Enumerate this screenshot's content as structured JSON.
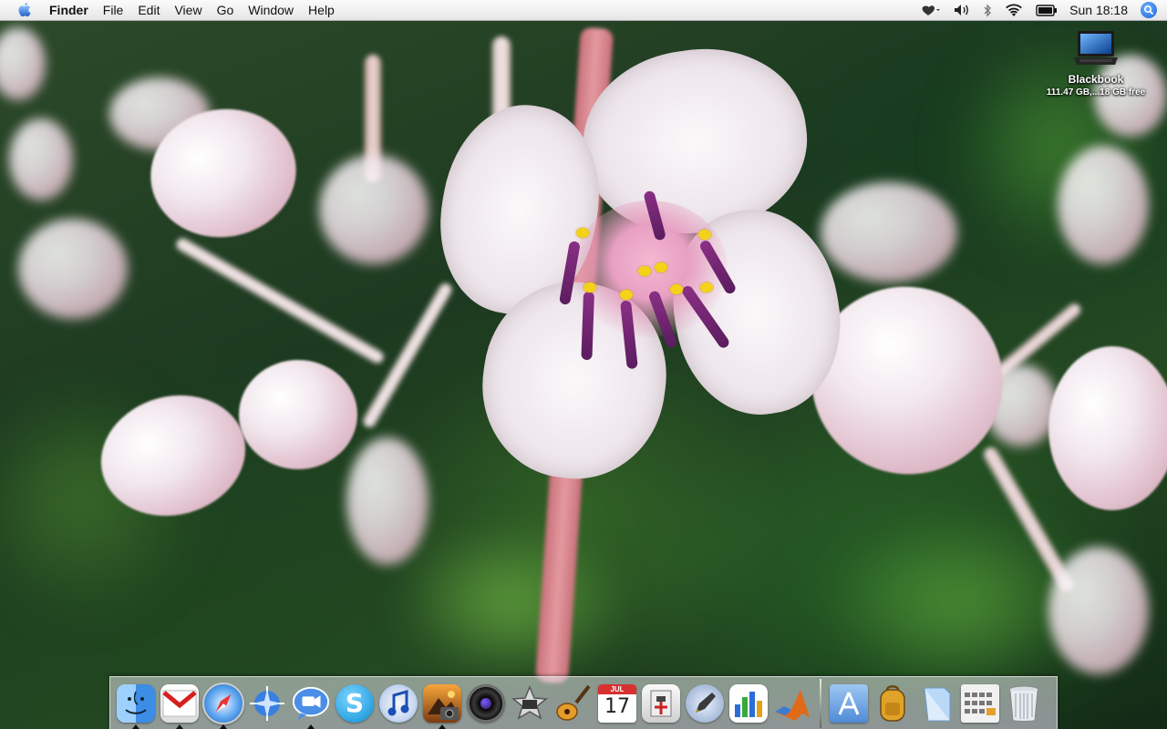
{
  "menubar": {
    "app_name": "Finder",
    "menus": [
      "File",
      "Edit",
      "View",
      "Go",
      "Window",
      "Help"
    ],
    "clock": "Sun 18:18"
  },
  "desktop": {
    "disk_name": "Blackbook",
    "disk_info": "111.47 GB,...18 GB free"
  },
  "dock": {
    "apps": [
      {
        "name": "Finder",
        "icon": "finder-icon",
        "running": true
      },
      {
        "name": "Mail",
        "icon": "mail-icon",
        "running": true
      },
      {
        "name": "Safari",
        "icon": "safari-icon",
        "running": true
      },
      {
        "name": "Globe",
        "icon": "globe-icon",
        "running": false
      },
      {
        "name": "iChat",
        "icon": "ichat-icon",
        "running": true
      },
      {
        "name": "Skype",
        "icon": "skype-icon",
        "running": false
      },
      {
        "name": "iTunes",
        "icon": "itunes-icon",
        "running": false
      },
      {
        "name": "iPhoto",
        "icon": "iphoto-icon",
        "running": true
      },
      {
        "name": "Aperture",
        "icon": "aperture-icon",
        "running": false
      },
      {
        "name": "iMovie",
        "icon": "imovie-icon",
        "running": false
      },
      {
        "name": "GarageBand",
        "icon": "garageband-icon",
        "running": false
      },
      {
        "name": "iCal",
        "icon": "ical-icon",
        "running": false
      },
      {
        "name": "Utility",
        "icon": "utility-icon",
        "running": false
      },
      {
        "name": "Script Editor",
        "icon": "pen-icon",
        "running": false
      },
      {
        "name": "Charts",
        "icon": "charts-icon",
        "running": false
      },
      {
        "name": "MATLAB",
        "icon": "matlab-icon",
        "running": false
      }
    ],
    "calendar_day": "17",
    "calendar_month": "JUL",
    "folders": [
      {
        "name": "Applications",
        "icon": "applications-folder-icon"
      },
      {
        "name": "Backpack",
        "icon": "backpack-icon"
      },
      {
        "name": "Documents",
        "icon": "documents-stack-icon"
      },
      {
        "name": "Grid",
        "icon": "grid-stack-icon"
      },
      {
        "name": "Trash",
        "icon": "trash-icon"
      }
    ]
  }
}
